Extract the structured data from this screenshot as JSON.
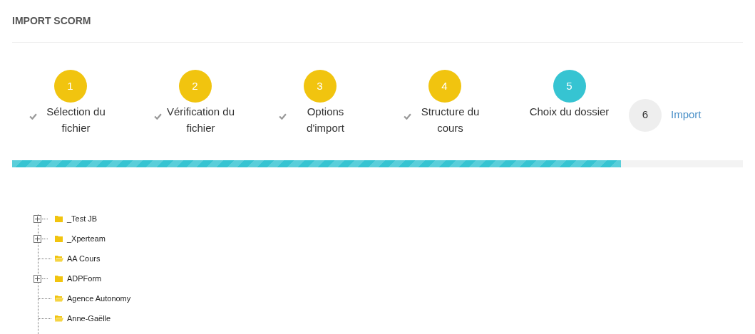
{
  "title": "IMPORT SCORM",
  "steps": [
    {
      "number": "1",
      "label": "Sélection du fichier",
      "done": true,
      "selected": false
    },
    {
      "number": "2",
      "label": "Vérification du fichier",
      "done": true,
      "selected": false
    },
    {
      "number": "3",
      "label": "Options d'import",
      "done": true,
      "selected": false
    },
    {
      "number": "4",
      "label": "Structure du cours",
      "done": true,
      "selected": false
    },
    {
      "number": "5",
      "label": "Choix du dossier",
      "done": false,
      "selected": true
    },
    {
      "number": "6",
      "label": "Import",
      "done": false,
      "selected": false
    }
  ],
  "progress": {
    "level": 0.833
  },
  "tree": [
    {
      "label": "_Test JB",
      "expandable": true
    },
    {
      "label": "_Xperteam",
      "expandable": true
    },
    {
      "label": "AA Cours",
      "expandable": false
    },
    {
      "label": "ADPForm",
      "expandable": true
    },
    {
      "label": "Agence Autonomy",
      "expandable": false
    },
    {
      "label": "Anne-Gaëlle",
      "expandable": false
    }
  ]
}
